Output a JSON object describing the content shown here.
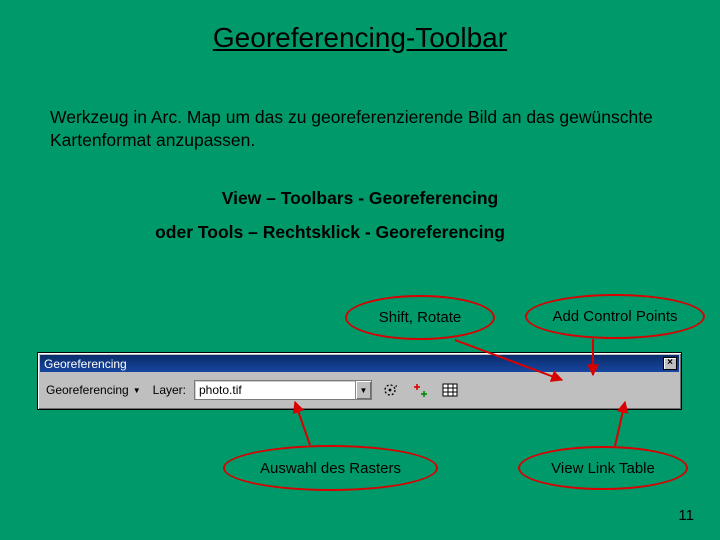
{
  "slide": {
    "title": "Georeferencing-Toolbar",
    "description": "Werkzeug in Arc. Map um das zu georeferenzierende Bild an das gewünschte Kartenformat anzupassen.",
    "menu_path_1": "View – Toolbars - Georeferencing",
    "menu_path_2": "oder Tools – Rechtsklick - Georeferencing",
    "page_number": "11"
  },
  "annotations": {
    "shift_rotate": "Shift, Rotate",
    "add_control_points": "Add Control Points",
    "raster_select": "Auswahl des Rasters",
    "view_link_table": "View Link Table"
  },
  "toolbar": {
    "window_title": "Georeferencing",
    "menu_label": "Georeferencing",
    "layer_label": "Layer:",
    "layer_value": "photo.tif",
    "icons": {
      "shift_rotate": "rotate-icon",
      "add_control_points": "control-points-icon",
      "view_link_table": "link-table-icon"
    }
  }
}
